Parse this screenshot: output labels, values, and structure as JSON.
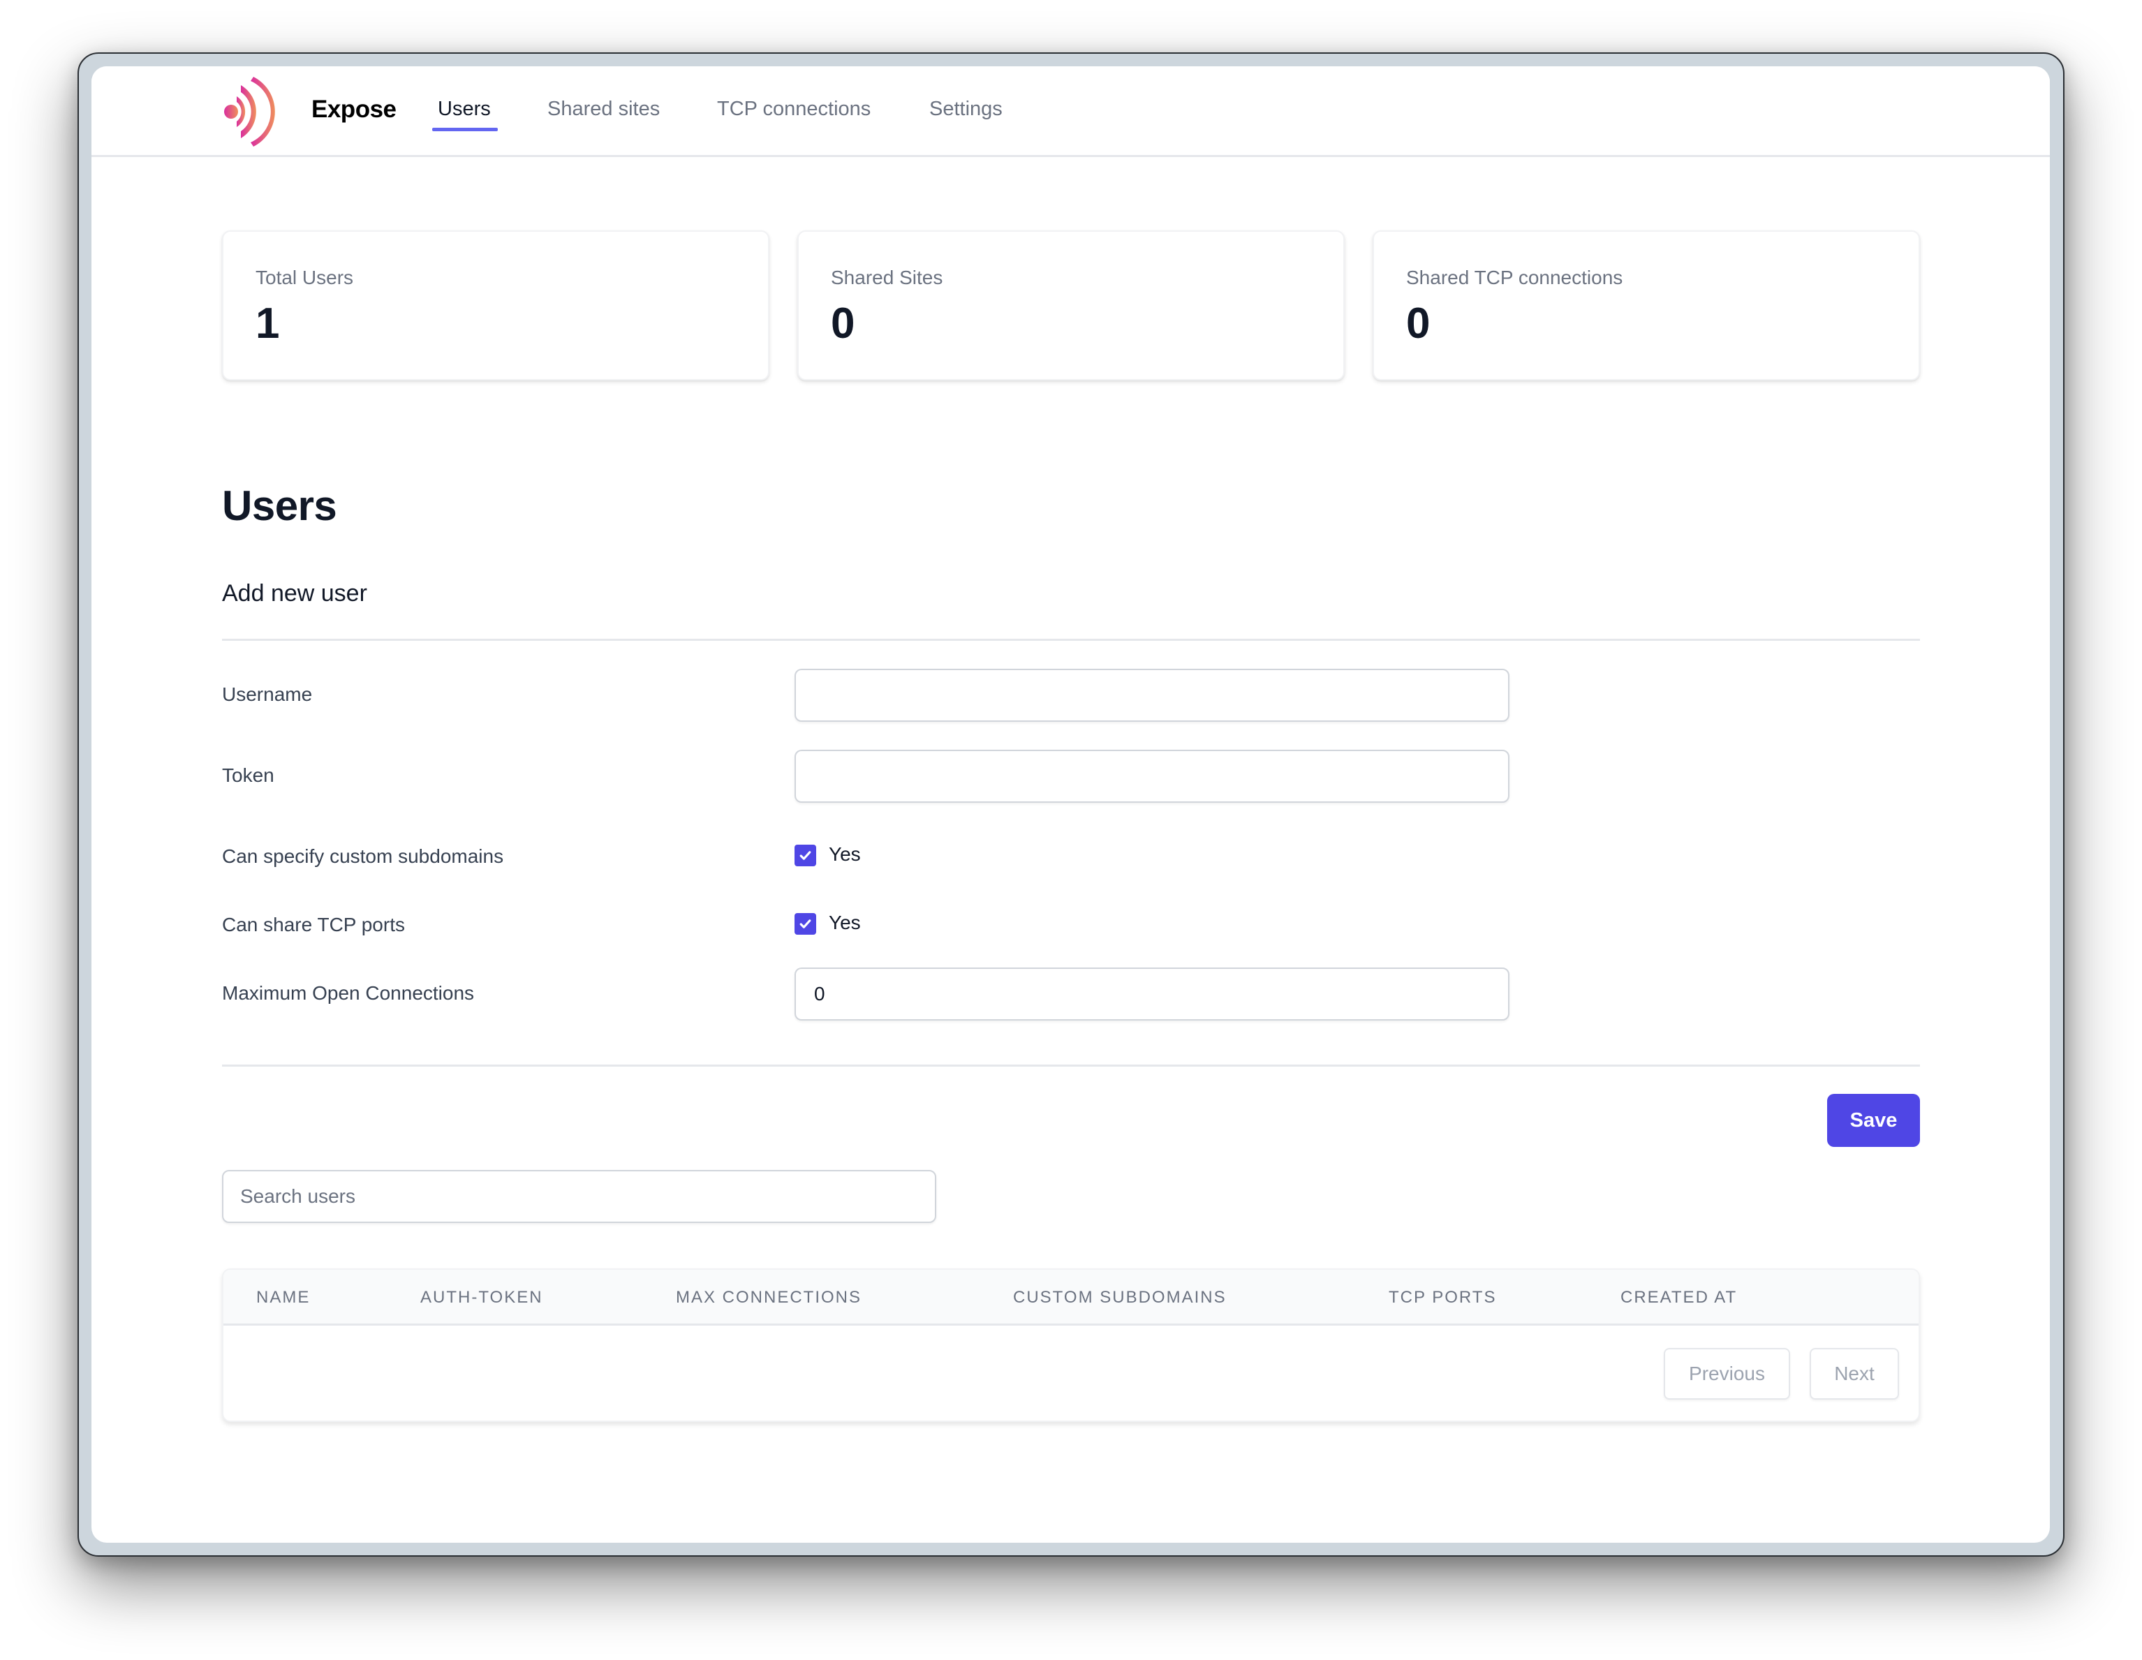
{
  "app": {
    "name": "Expose"
  },
  "nav": {
    "items": [
      {
        "label": "Users",
        "active": true
      },
      {
        "label": "Shared sites",
        "active": false
      },
      {
        "label": "TCP connections",
        "active": false
      },
      {
        "label": "Settings",
        "active": false
      }
    ]
  },
  "stats": [
    {
      "label": "Total Users",
      "value": "1"
    },
    {
      "label": "Shared Sites",
      "value": "0"
    },
    {
      "label": "Shared TCP connections",
      "value": "0"
    }
  ],
  "page": {
    "title": "Users"
  },
  "form": {
    "title": "Add new user",
    "username": {
      "label": "Username",
      "value": ""
    },
    "token": {
      "label": "Token",
      "value": ""
    },
    "custom_subdomains": {
      "label": "Can specify custom subdomains",
      "checked": true,
      "option": "Yes"
    },
    "tcp_ports": {
      "label": "Can share TCP ports",
      "checked": true,
      "option": "Yes"
    },
    "max_connections": {
      "label": "Maximum Open Connections",
      "value": "0"
    },
    "save_label": "Save"
  },
  "search": {
    "placeholder": "Search users",
    "value": ""
  },
  "table": {
    "columns": [
      "NAME",
      "AUTH-TOKEN",
      "MAX CONNECTIONS",
      "CUSTOM SUBDOMAINS",
      "TCP PORTS",
      "CREATED AT"
    ],
    "rows": [],
    "pagination": {
      "previous_label": "Previous",
      "next_label": "Next"
    }
  },
  "colors": {
    "accent": "#4f46e5",
    "nav_underline": "#6366f1",
    "logo_gradient": [
      "#d92e9e",
      "#ef8f5c"
    ]
  }
}
